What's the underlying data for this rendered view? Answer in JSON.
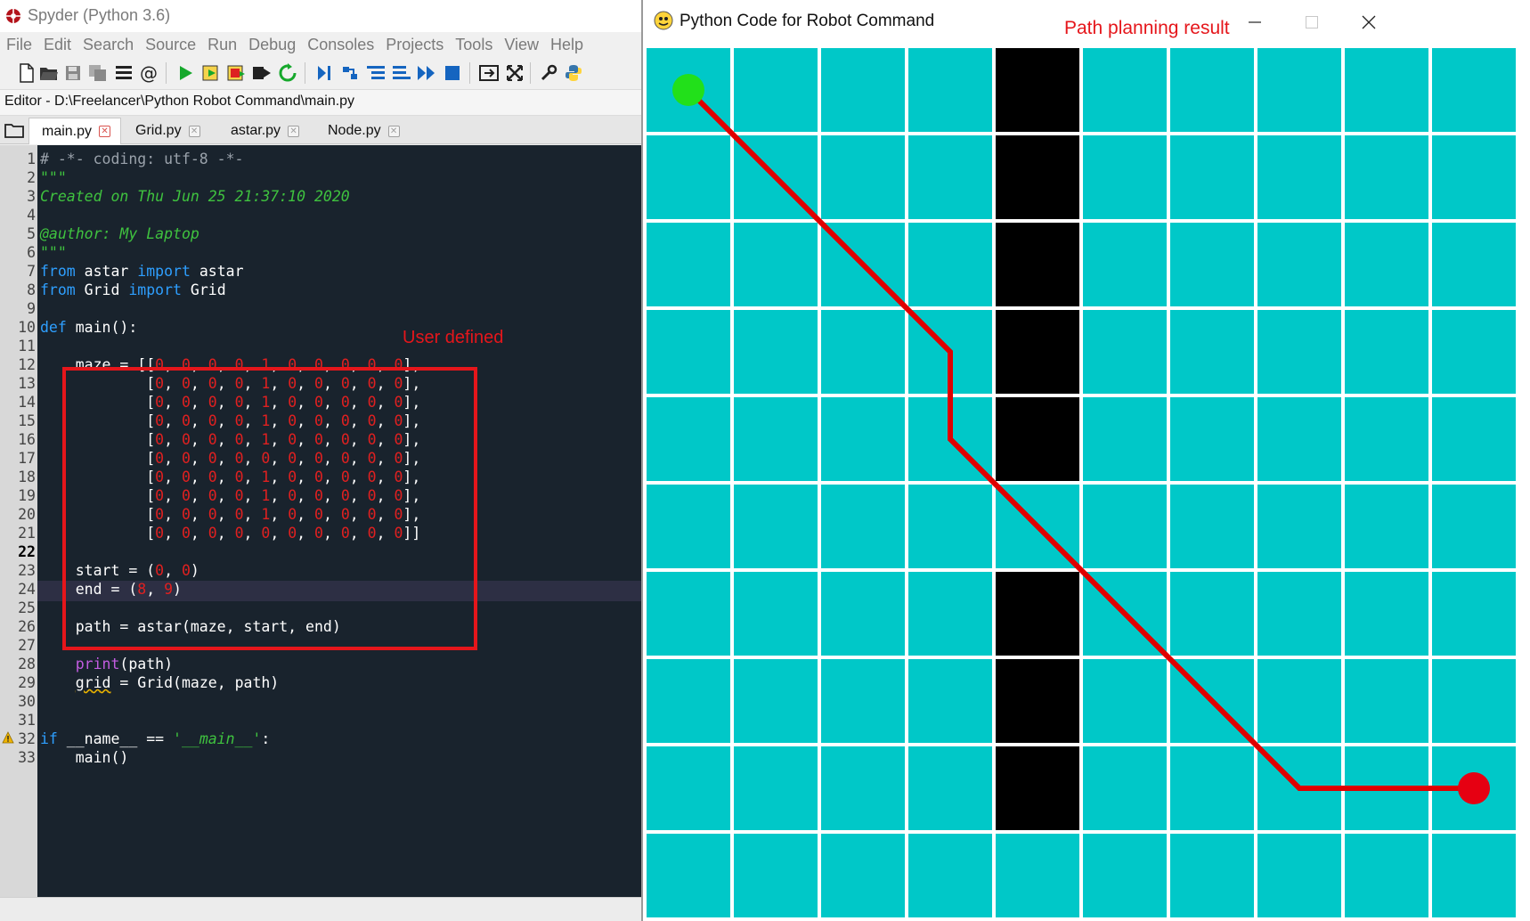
{
  "spyder": {
    "title": "Spyder (Python 3.6)",
    "menu": [
      "File",
      "Edit",
      "Search",
      "Source",
      "Run",
      "Debug",
      "Consoles",
      "Projects",
      "Tools",
      "View",
      "Help"
    ],
    "editor_path": "Editor - D:\\Freelancer\\Python Robot Command\\main.py",
    "tabs": [
      {
        "label": "main.py",
        "active": true,
        "modified": true
      },
      {
        "label": "Grid.py",
        "active": false,
        "modified": false
      },
      {
        "label": "astar.py",
        "active": false,
        "modified": false
      },
      {
        "label": "Node.py",
        "active": false,
        "modified": false
      }
    ],
    "annotation": "User defined",
    "current_line": 22,
    "warning_line": 29,
    "code": [
      "# -*- coding: utf-8 -*-",
      "\"\"\"",
      "Created on Thu Jun 25 21:37:10 2020",
      "",
      "@author: My Laptop",
      "\"\"\"",
      "from astar import astar",
      "from Grid import Grid",
      "",
      "def main():",
      "",
      "    maze = [[0, 0, 0, 0, 1, 0, 0, 0, 0, 0],",
      "            [0, 0, 0, 0, 1, 0, 0, 0, 0, 0],",
      "            [0, 0, 0, 0, 1, 0, 0, 0, 0, 0],",
      "            [0, 0, 0, 0, 1, 0, 0, 0, 0, 0],",
      "            [0, 0, 0, 0, 1, 0, 0, 0, 0, 0],",
      "            [0, 0, 0, 0, 0, 0, 0, 0, 0, 0],",
      "            [0, 0, 0, 0, 1, 0, 0, 0, 0, 0],",
      "            [0, 0, 0, 0, 1, 0, 0, 0, 0, 0],",
      "            [0, 0, 0, 0, 1, 0, 0, 0, 0, 0],",
      "            [0, 0, 0, 0, 0, 0, 0, 0, 0, 0]]",
      "",
      "    start = (0, 0)",
      "    end = (8, 9)",
      "",
      "    path = astar(maze, start, end)",
      "",
      "    print(path)",
      "    grid = Grid(maze, path)",
      "",
      "",
      "if __name__ == '__main__':",
      "    main()"
    ]
  },
  "pygame": {
    "title": "Python Code for Robot Command",
    "annotation": "Path planning result",
    "grid": {
      "cells": [
        [
          0,
          0,
          0,
          0,
          1,
          0,
          0,
          0,
          0,
          0
        ],
        [
          0,
          0,
          0,
          0,
          1,
          0,
          0,
          0,
          0,
          0
        ],
        [
          0,
          0,
          0,
          0,
          1,
          0,
          0,
          0,
          0,
          0
        ],
        [
          0,
          0,
          0,
          0,
          1,
          0,
          0,
          0,
          0,
          0
        ],
        [
          0,
          0,
          0,
          0,
          1,
          0,
          0,
          0,
          0,
          0
        ],
        [
          0,
          0,
          0,
          0,
          0,
          0,
          0,
          0,
          0,
          0
        ],
        [
          0,
          0,
          0,
          0,
          1,
          0,
          0,
          0,
          0,
          0
        ],
        [
          0,
          0,
          0,
          0,
          1,
          0,
          0,
          0,
          0,
          0
        ],
        [
          0,
          0,
          0,
          0,
          1,
          0,
          0,
          0,
          0,
          0
        ],
        [
          0,
          0,
          0,
          0,
          0,
          0,
          0,
          0,
          0,
          0
        ]
      ],
      "path": [
        [
          0,
          0
        ],
        [
          1,
          1
        ],
        [
          2,
          2
        ],
        [
          3,
          3
        ],
        [
          4,
          3
        ],
        [
          5,
          4
        ],
        [
          6,
          5
        ],
        [
          7,
          6
        ],
        [
          8,
          7
        ],
        [
          8,
          8
        ],
        [
          8,
          9
        ]
      ],
      "start": [
        0,
        0
      ],
      "end": [
        8,
        9
      ],
      "free_color": "#00c8c8",
      "wall_color": "#000000",
      "line_color": "#ffffff",
      "path_color": "#e00000",
      "start_color": "#22e01a",
      "end_color": "#e60012"
    }
  }
}
